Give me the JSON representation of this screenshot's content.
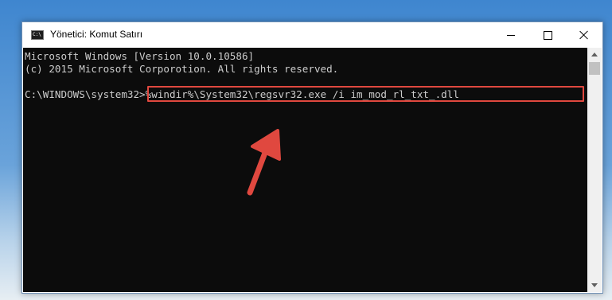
{
  "window": {
    "title": "Yönetici: Komut Satırı",
    "icon_text": "C:\\"
  },
  "console": {
    "line1": "Microsoft Windows [Version 10.0.10586]",
    "line2": "(c) 2015 Microsoft Corporotion. All rights reserved.",
    "prompt": "C:\\WINDOWS\\system32>",
    "command": "%windir%\\System32\\regsvr32.exe /i im_mod_rl_txt_.dll"
  },
  "colors": {
    "console_bg": "#0c0c0c",
    "console_text": "#cccccc",
    "highlight": "#e0483f",
    "arrow": "#e0483f"
  }
}
